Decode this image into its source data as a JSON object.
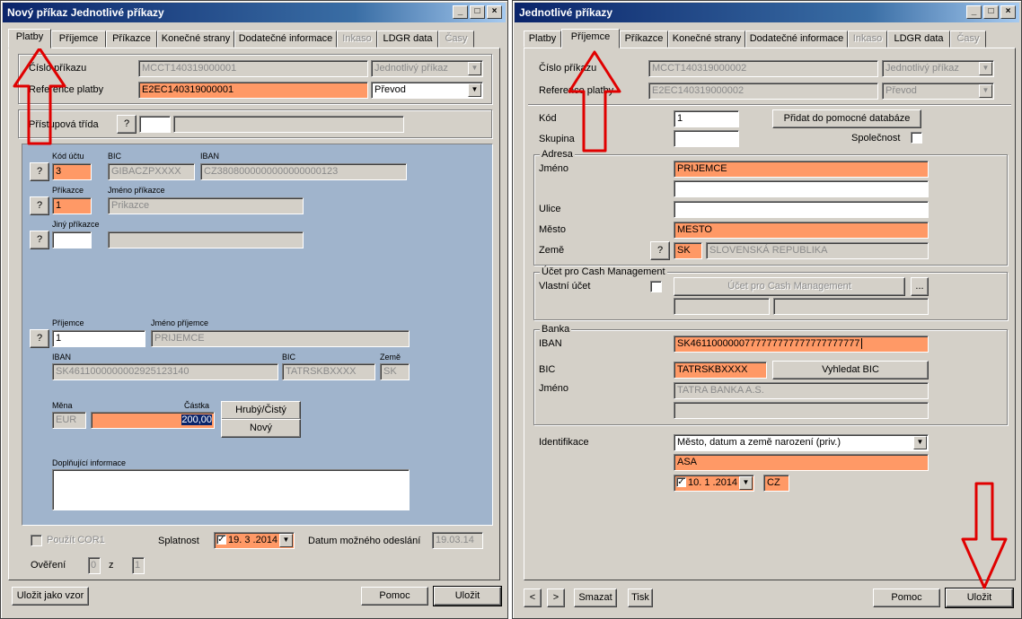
{
  "left": {
    "title": "Nový příkaz Jednotlivé příkazy",
    "tabs": [
      {
        "label": "Platby"
      },
      {
        "label": "Příjemce"
      },
      {
        "label": "Příkazce"
      },
      {
        "label": "Konečné strany"
      },
      {
        "label": "Dodatečné informace"
      },
      {
        "label": "Inkaso"
      },
      {
        "label": "LDGR data"
      },
      {
        "label": "Časy"
      }
    ],
    "cislo_prikazu_label": "Číslo příkazu",
    "cislo_prikazu": "MCCT140319000001",
    "typ_prikazu": "Jednotlivý příkaz",
    "reference_label": "Reference platby",
    "reference": "E2EC140319000001",
    "reference_type": "Převod",
    "pristupova_label": "Přístupová třída",
    "help": "?",
    "kod_uctu_label": "Kód účtu",
    "kod_uctu": "3",
    "bic_label": "BIC",
    "bic": "GIBACZPXXXX",
    "iban_label": "IBAN",
    "iban": "CZ3808000000000000000123",
    "prikazce_label": "Příkazce",
    "prikazce": "1",
    "jmeno_prikazce_label": "Jméno příkazce",
    "jmeno_prikazce": "Prikazce",
    "jiny_prikazce_label": "Jiný příkazce",
    "prijemce_label": "Příjemce",
    "prijemce": "1",
    "jmeno_prijemce_label": "Jméno příjemce",
    "jmeno_prijemce": "PRIJEMCE",
    "iban2_label": "IBAN",
    "iban2": "SK4611000000002925123140",
    "bic2_label": "BIC",
    "bic2": "TATRSKBXXXX",
    "zeme_label": "Země",
    "zeme": "SK",
    "mena_label": "Měna",
    "mena": "EUR",
    "castka_label": "Částka",
    "castka": "200,00",
    "hruby_btn": "Hrubý/Čistý",
    "novy_btn": "Nový",
    "doplnujici_label": "Doplňující informace",
    "pouzit_cor1": "Použít COR1",
    "splatnost_label": "Splatnost",
    "splatnost": "19. 3 .2014",
    "datum_odeslani_label": "Datum možného odeslání",
    "datum_odeslani": "19.03.14",
    "overeni_label": "Ověření",
    "overeni_val": "0",
    "z_label": "z",
    "overeni_total": "1",
    "ulozit_vzor": "Uložit jako vzor",
    "pomoc": "Pomoc",
    "ulozit": "Uložit"
  },
  "right": {
    "title": "Jednotlivé příkazy",
    "tabs": [
      {
        "label": "Platby"
      },
      {
        "label": "Příjemce"
      },
      {
        "label": "Příkazce"
      },
      {
        "label": "Konečné strany"
      },
      {
        "label": "Dodatečné informace"
      },
      {
        "label": "Inkaso"
      },
      {
        "label": "LDGR data"
      },
      {
        "label": "Časy"
      }
    ],
    "cislo_prikazu_label": "Číslo příkazu",
    "cislo_prikazu": "MCCT140319000002",
    "typ_prikazu": "Jednotlivý příkaz",
    "reference_label": "Reference platby",
    "reference": "E2EC140319000002",
    "reference_type": "Převod",
    "kod_label": "Kód",
    "kod": "1",
    "pridat_btn": "Přidat do pomocné databáze",
    "skupina_label": "Skupina",
    "spolecnost_label": "Společnost",
    "adresa_title": "Adresa",
    "jmeno_label": "Jméno",
    "jmeno": "PRIJEMCE",
    "ulice_label": "Ulice",
    "mesto_label": "Město",
    "mesto": "MESTO",
    "zeme_label": "Země",
    "help": "?",
    "zeme_code": "SK",
    "zeme_name": "SLOVENSKÁ REPUBLIKA",
    "ucet_cm_title": "Účet pro Cash Management",
    "vlastni_ucet_label": "Vlastní účet",
    "ucet_cm_btn": "Účet pro Cash Management",
    "ellipsis": "...",
    "banka_title": "Banka",
    "iban_label": "IBAN",
    "iban": "SK4611000000777777777777777777777",
    "bic_label": "BIC",
    "bic": "TATRSKBXXXX",
    "vyhledat_btn": "Vyhledat BIC",
    "banka_jmeno_label": "Jméno",
    "banka_jmeno": "TATRA BANKA A.S.",
    "identifikace_label": "Identifikace",
    "identifikace": "Město, datum a země narození (priv.)",
    "id_value": "ASA",
    "id_date": "10. 1 .2014",
    "id_country": "CZ",
    "prev_btn": "<",
    "next_btn": ">",
    "smazat": "Smazat",
    "tisk": "Tisk",
    "pomoc": "Pomoc",
    "ulozit": "Uložit"
  },
  "colors": {
    "highlight": "#ff9966",
    "window_bg": "#d4d0c8",
    "blue_panel": "#a0b4cc",
    "arrow_red": "#e00000"
  },
  "window_buttons": {
    "min": "_",
    "max": "□",
    "close": "×"
  }
}
